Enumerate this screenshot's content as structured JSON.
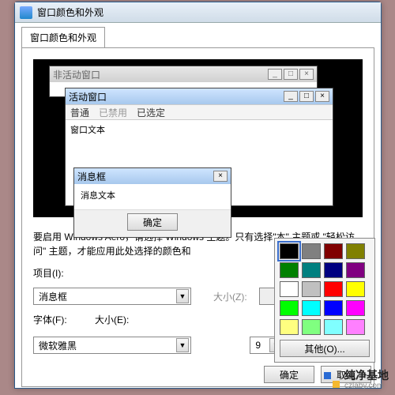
{
  "dialog": {
    "title": "窗口颜色和外观",
    "tab": "窗口颜色和外观",
    "buttons": {
      "ok": "确定",
      "cancel": "取消"
    }
  },
  "preview": {
    "inactive": "非活动窗口",
    "active": "活动窗口",
    "menu": {
      "normal": "普通",
      "disabled": "已禁用",
      "selected": "已选定"
    },
    "windowText": "窗口文本",
    "msgbox": {
      "title": "消息框",
      "text": "消息文本",
      "ok": "确定"
    },
    "winctl": {
      "min": "_",
      "max": "□",
      "close": "×"
    }
  },
  "info": "要启用 Windows Aero，请选择 Windows 主题。只有选择\"本\" 主题或 \"轻松访问\" 主题，才能应用此处选择的颜色和",
  "form": {
    "item_label": "项目(I):",
    "item_value": "消息框",
    "size1_label": "大小(Z):",
    "size1_value": "",
    "font_label": "字体(F):",
    "font_value": "微软雅黑",
    "size2_label": "大小(E):",
    "size2_value": "9",
    "arrow": "▼",
    "up": "▲",
    "down": "▼"
  },
  "palette": {
    "other": "其他(O)...",
    "colors": [
      "#000000",
      "#808080",
      "#800000",
      "#808000",
      "#008000",
      "#008080",
      "#000080",
      "#800080",
      "#ffffff",
      "#c0c0c0",
      "#ff0000",
      "#ffff00",
      "#00ff00",
      "#00ffff",
      "#0000ff",
      "#ff00ff",
      "#ffff80",
      "#80ff80",
      "#80ffff",
      "#ff80ff"
    ],
    "selected_index": 0
  },
  "color_swatch": "#000000",
  "watermark": {
    "name": "纯净基地",
    "url": "czlaby.com"
  }
}
